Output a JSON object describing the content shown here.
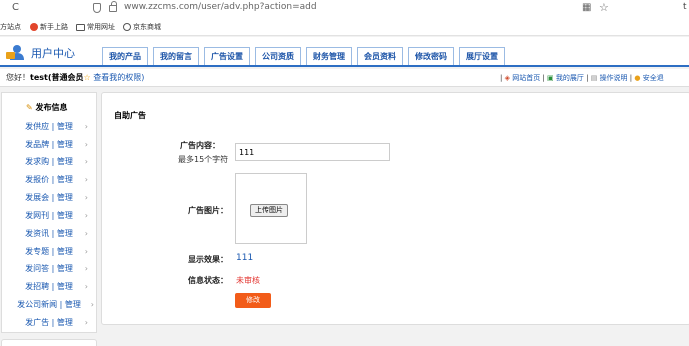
{
  "browser": {
    "url": "www.zzcms.com/user/adv.php?action=add",
    "bookmarks": [
      "方站点",
      "新手上路",
      "常用网址",
      "京东商城"
    ],
    "trailing_char": "t"
  },
  "header": {
    "logo_text": "用户中心",
    "tabs": [
      "我的产品",
      "我的留言",
      "广告设置",
      "公司资质",
      "财务管理",
      "会员资料",
      "修改密码",
      "展厅设置"
    ]
  },
  "welcome": {
    "greeting": "您好！",
    "username": "test",
    "member_type": "(普通会员",
    "permission_link": "查看我的权限)",
    "links": [
      "网站首页",
      "我的展厅",
      "操作说明",
      "安全退"
    ]
  },
  "sidebar": {
    "title": "发布信息",
    "items": [
      {
        "label": "发供应 | 管理"
      },
      {
        "label": "发品牌 | 管理"
      },
      {
        "label": "发求购 | 管理"
      },
      {
        "label": "发报价 | 管理"
      },
      {
        "label": "发展会 | 管理"
      },
      {
        "label": "发网刊 | 管理"
      },
      {
        "label": "发资讯 | 管理"
      },
      {
        "label": "发专题 | 管理"
      },
      {
        "label": "发问答 | 管理"
      },
      {
        "label": "发招聘 | 管理"
      },
      {
        "label": "发公司新闻 | 管理"
      },
      {
        "label": "发广告 | 管理"
      }
    ]
  },
  "form": {
    "title": "自助广告",
    "content_label": "广告内容：",
    "content_hint": "最多15个字符",
    "content_value": "111",
    "image_label": "广告图片：",
    "upload_button": "上传图片",
    "preview_label": "显示效果：",
    "preview_value": "111",
    "status_label": "信息状态：",
    "status_value": "未审核",
    "submit_button": "修改"
  }
}
